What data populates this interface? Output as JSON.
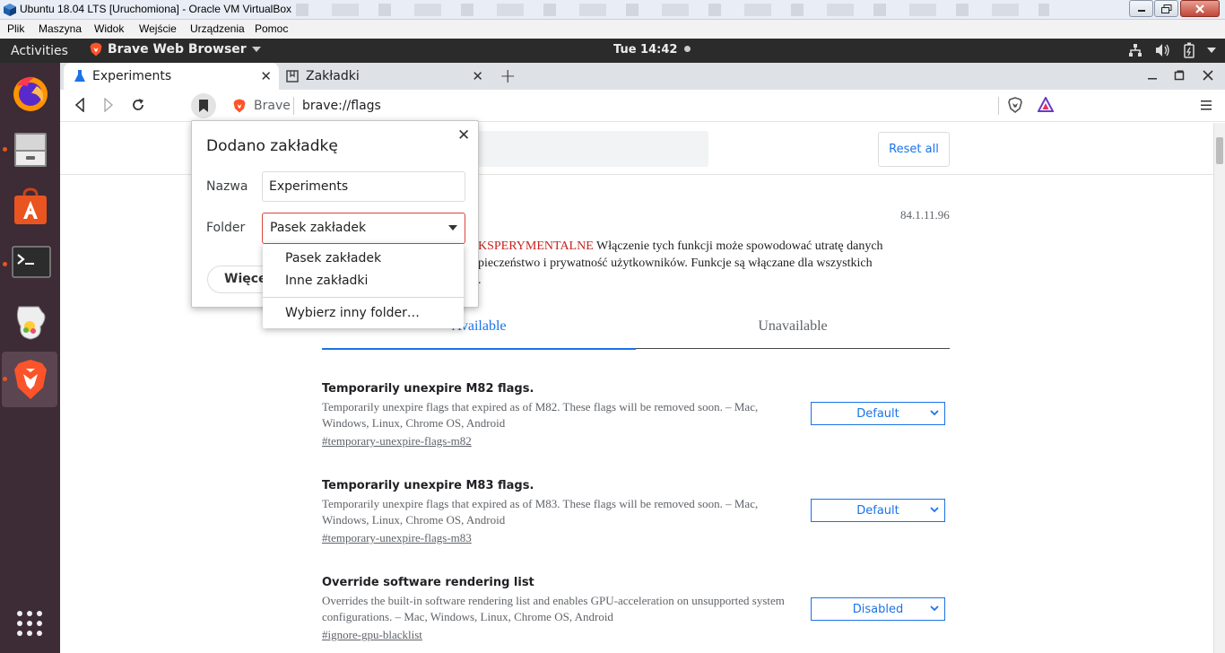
{
  "window": {
    "title": "Ubuntu 18.04 LTS [Uruchomiona] - Oracle VM VirtualBox"
  },
  "vbox_menu": [
    "Plik",
    "Maszyna",
    "Widok",
    "Wejście",
    "Urządzenia",
    "Pomoc"
  ],
  "ubuntu_panel": {
    "activities": "Activities",
    "app_name": "Brave Web Browser",
    "clock": "Tue 14:42"
  },
  "dock": {
    "items": [
      "firefox-icon",
      "files-icon",
      "software-center-icon",
      "terminal-icon",
      "libreoffice-draw-icon",
      "brave-icon"
    ],
    "active_index": 5
  },
  "tabs": [
    {
      "label": "Experiments",
      "active": true
    },
    {
      "label": "Zakładki",
      "active": false
    }
  ],
  "omnibox": {
    "site_label": "Brave",
    "url": "brave://flags"
  },
  "page": {
    "reset_all": "Reset all",
    "version": "84.1.11.96",
    "warning_red": "KSPERYMENTALNE",
    "warning_line1": " Włączenie tych funkcji może spowodować utratę danych",
    "warning_line2": "pieczeństwo i prywatność użytkowników. Funkcje są włączane dla wszystkich",
    "warning_line3": ".",
    "tab_available": "Available",
    "tab_unavailable": "Unavailable",
    "flags": [
      {
        "name": "Temporarily unexpire M82 flags.",
        "description": "Temporarily unexpire flags that expired as of M82. These flags will be removed soon. – Mac, Windows, Linux, Chrome OS, Android",
        "link": "#temporary-unexpire-flags-m82",
        "value": "Default"
      },
      {
        "name": "Temporarily unexpire M83 flags.",
        "description": "Temporarily unexpire flags that expired as of M83. These flags will be removed soon. – Mac, Windows, Linux, Chrome OS, Android",
        "link": "#temporary-unexpire-flags-m83",
        "value": "Default"
      },
      {
        "name": "Override software rendering list",
        "description": "Overrides the built-in software rendering list and enables GPU-acceleration on unsupported system configurations. – Mac, Windows, Linux, Chrome OS, Android",
        "link": "#ignore-gpu-blacklist",
        "value": "Disabled"
      }
    ]
  },
  "bookmark_dialog": {
    "title": "Dodano zakładkę",
    "name_label": "Nazwa",
    "name_value": "Experiments",
    "folder_label": "Folder",
    "folder_value": "Pasek zakładek",
    "more_button": "Więcej",
    "folder_options": [
      "Pasek zakładek",
      "Inne zakładki",
      "Wybierz inny folder…"
    ]
  },
  "colors": {
    "accent": "#1a73e8",
    "warning_red": "#c5221f",
    "ubuntu_orange": "#e95420",
    "dock_bg": "#3d2b35"
  }
}
